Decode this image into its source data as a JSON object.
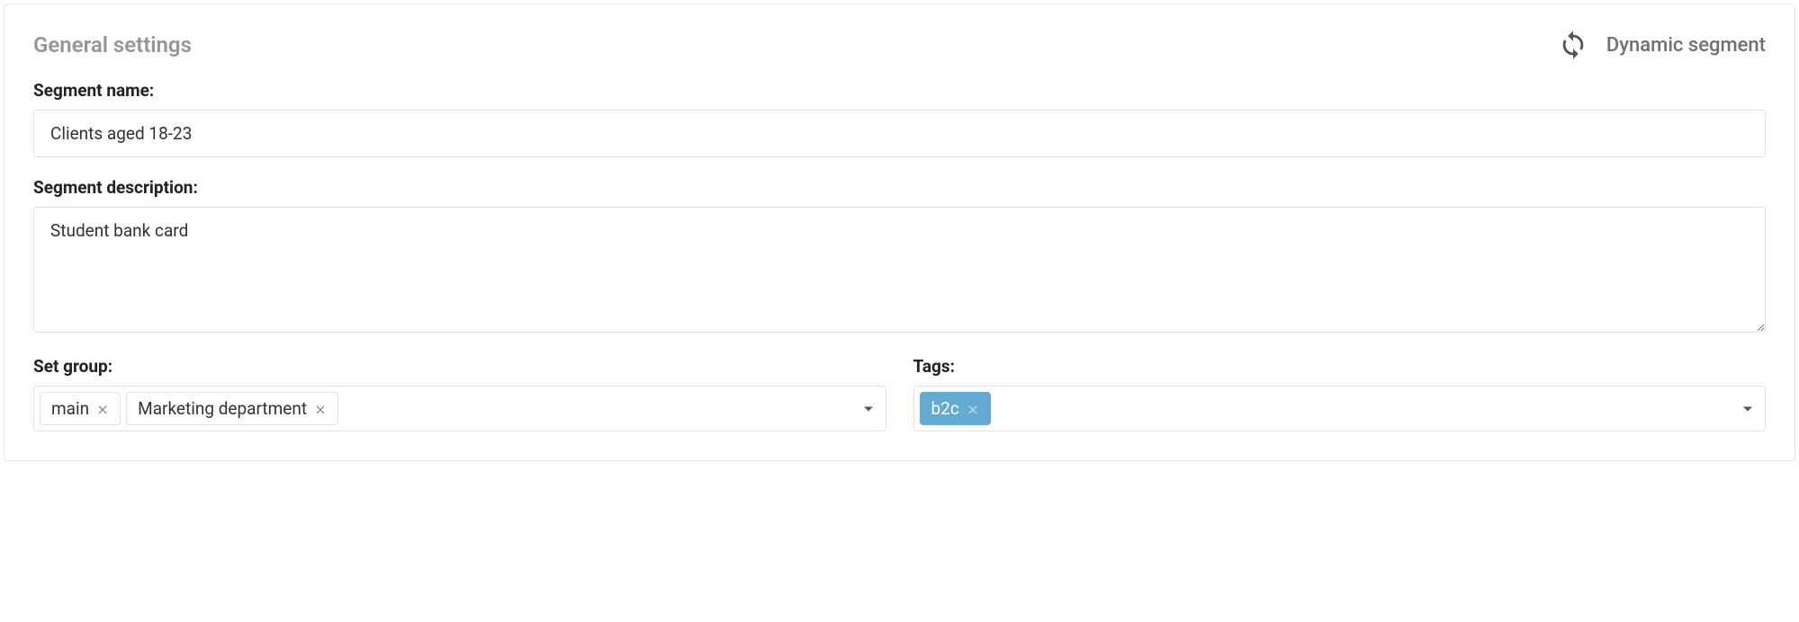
{
  "header": {
    "title": "General settings",
    "segment_type_label": "Dynamic segment"
  },
  "fields": {
    "segment_name": {
      "label": "Segment name:",
      "value": "Clients aged 18-23"
    },
    "segment_description": {
      "label": "Segment description:",
      "value": "Student bank card"
    },
    "set_group": {
      "label": "Set group:",
      "chips": [
        "main",
        "Marketing department"
      ]
    },
    "tags": {
      "label": "Tags:",
      "chips": [
        "b2c"
      ]
    }
  }
}
